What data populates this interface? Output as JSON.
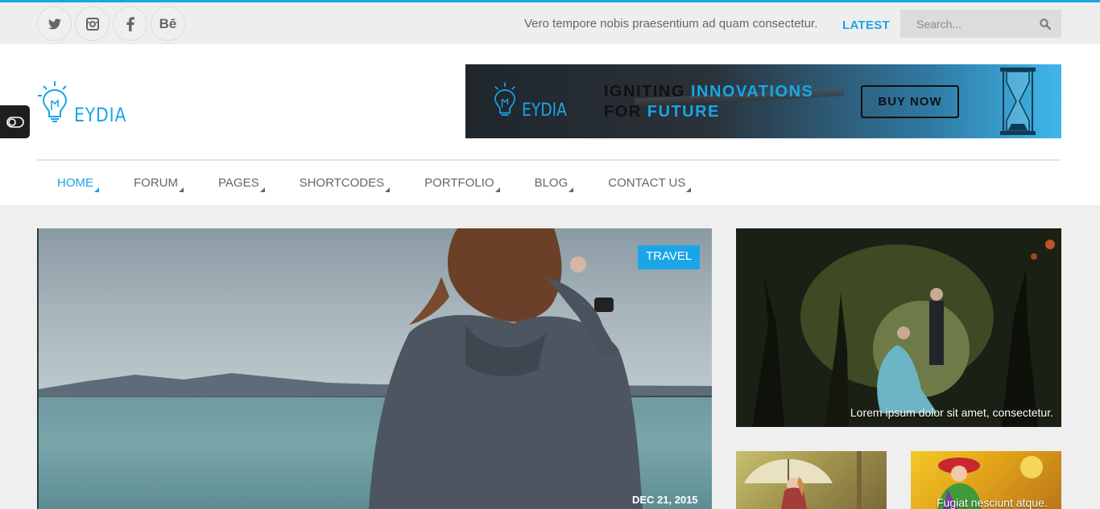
{
  "topbar": {
    "social": [
      {
        "name": "twitter-icon"
      },
      {
        "name": "instagram-icon"
      },
      {
        "name": "facebook-icon"
      },
      {
        "name": "behance-icon",
        "label": "Bē"
      }
    ],
    "ticker_text": "Vero tempore nobis praesentium ad quam consectetur.",
    "latest_label": "LATEST",
    "search_placeholder": "Search..."
  },
  "header": {
    "logo_text": "EYDIA",
    "banner": {
      "logo_text": "EYDIA",
      "line1_a": "IGNITING ",
      "line1_b": "INNOVATIONS",
      "line2_a": "FOR ",
      "line2_b": "FUTURE",
      "button_label": "BUY NOW"
    }
  },
  "nav": {
    "items": [
      {
        "label": "HOME",
        "active": true
      },
      {
        "label": "FORUM"
      },
      {
        "label": "PAGES"
      },
      {
        "label": "SHORTCODES"
      },
      {
        "label": "PORTFOLIO"
      },
      {
        "label": "BLOG"
      },
      {
        "label": "CONTACT US"
      }
    ]
  },
  "main_post": {
    "category": "TRAVEL",
    "date": "DEC 21, 2015"
  },
  "side_post": {
    "caption": "Lorem ipsum dolor sit amet, consectetur."
  },
  "thumbs": [
    {
      "caption": ""
    },
    {
      "caption": "Fugiat nesciunt atque."
    }
  ],
  "colors": {
    "accent": "#1aa5e6",
    "topbar_bg": "#eeeeee",
    "content_bg": "#efefef"
  }
}
